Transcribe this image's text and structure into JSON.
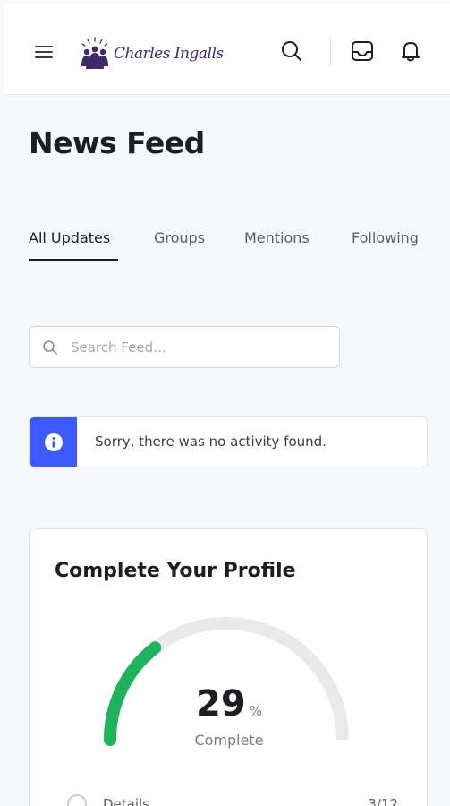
{
  "header": {
    "site_name": "Charles Ingalls",
    "icons": [
      "menu-icon",
      "search-icon",
      "inbox-icon",
      "bell-icon"
    ]
  },
  "page": {
    "title": "News Feed"
  },
  "tabs": [
    {
      "label": "All Updates",
      "active": true
    },
    {
      "label": "Groups",
      "active": false
    },
    {
      "label": "Mentions",
      "active": false
    },
    {
      "label": "Following",
      "active": false
    }
  ],
  "search": {
    "placeholder": "Search Feed…",
    "value": ""
  },
  "notice": {
    "text": "Sorry, there was no activity found.",
    "accent": "#3d5afe"
  },
  "profile_card": {
    "title": "Complete Your Profile",
    "percent": "29",
    "percent_sign": "%",
    "percent_label": "Complete",
    "progress_fraction": 0.29,
    "progress_color": "#1fb35b",
    "track_color": "#e9e9eb",
    "details": [
      {
        "label": "Details",
        "count": "3/12"
      }
    ]
  }
}
